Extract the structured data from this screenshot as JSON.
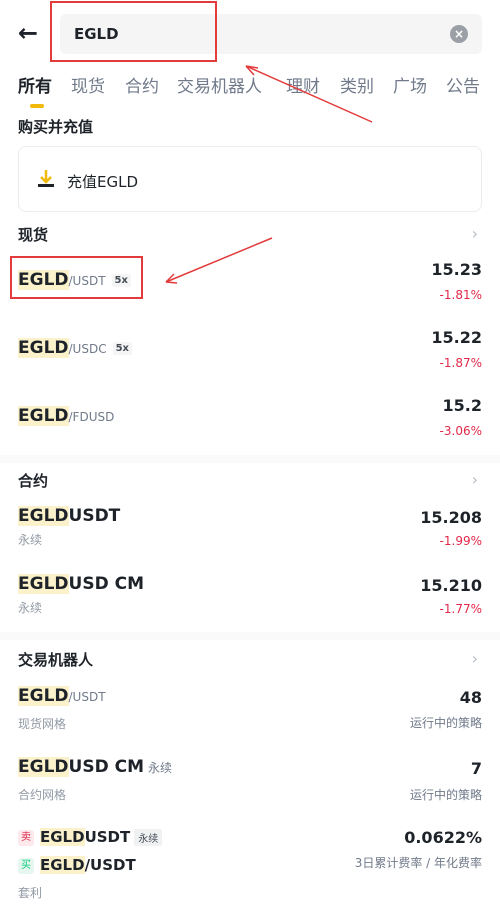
{
  "search": {
    "query": "EGLD"
  },
  "tabs": [
    "所有",
    "现货",
    "合约",
    "交易机器人",
    "理财",
    "类别",
    "广场",
    "公告"
  ],
  "buy_section": {
    "title": "购买并充值",
    "deposit_label": "充值EGLD"
  },
  "spot": {
    "title": "现货",
    "rows": [
      {
        "base": "EGLD",
        "quote": "/USDT",
        "lev": "5x",
        "price": "15.23",
        "change": "-1.81%"
      },
      {
        "base": "EGLD",
        "quote": "/USDC",
        "lev": "5x",
        "price": "15.22",
        "change": "-1.87%"
      },
      {
        "base": "EGLD",
        "quote": "/FDUSD",
        "lev": "",
        "price": "15.2",
        "change": "-3.06%"
      }
    ]
  },
  "futures": {
    "title": "合约",
    "rows": [
      {
        "hl": "EGLD",
        "rest": "USDT",
        "sub": "永续",
        "price": "15.208",
        "change": "-1.99%"
      },
      {
        "hl": "EGLD",
        "rest": "USD CM",
        "sub": "永续",
        "price": "15.210",
        "change": "-1.77%"
      }
    ]
  },
  "bots": {
    "title": "交易机器人",
    "rows": [
      {
        "hl": "EGLD",
        "rest": "/USDT",
        "sub": "现货网格",
        "value": "48",
        "value_label": "运行中的策略"
      },
      {
        "hl": "EGLD",
        "rest": "USD CM",
        "tag": "永续",
        "sub": "合约网格",
        "value": "7",
        "value_label": "运行中的策略"
      }
    ],
    "arb": {
      "sell_badge": "卖",
      "sell_hl": "EGLD",
      "sell_rest": "USDT",
      "sell_tag": "永续",
      "buy_badge": "买",
      "buy_hl": "EGLD",
      "buy_rest": "/USDT",
      "sub": "套利",
      "value": "0.0622%",
      "value_label": "3日累计费率 / 年化费率"
    }
  },
  "colors": {
    "accent": "#f0b90b",
    "down": "#e0294a",
    "up": "#0ecb81",
    "annotation": "#e23b3b"
  }
}
